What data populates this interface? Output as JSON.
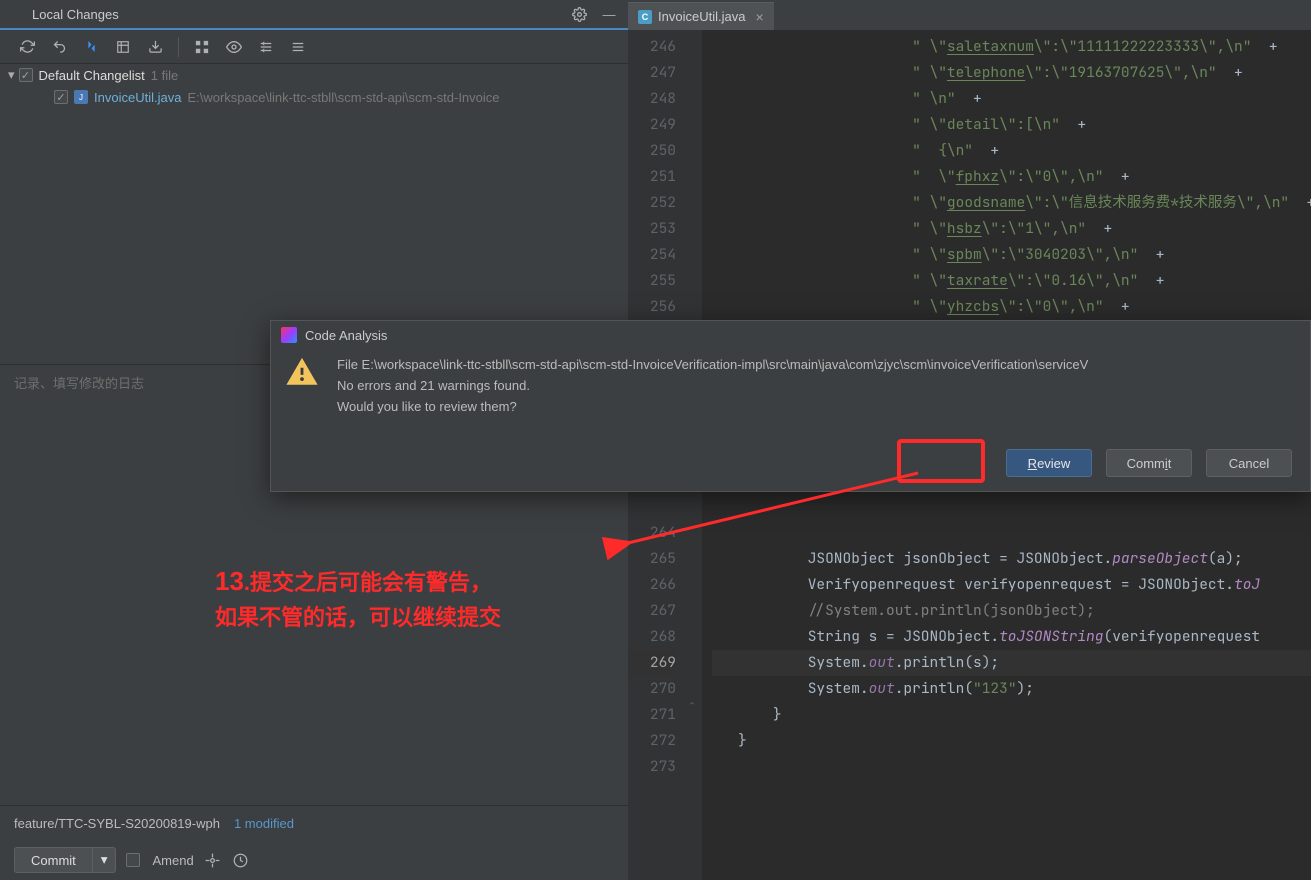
{
  "leftPanel": {
    "title": "Local Changes",
    "changelist": {
      "label": "Default Changelist",
      "count": "1 file"
    },
    "file": {
      "name": "InvoiceUtil.java",
      "path": "E:\\workspace\\link-ttc-stbll\\scm-std-api\\scm-std-Invoice"
    },
    "message_placeholder": "记录、填写修改的日志",
    "branch": "feature/TTC-SYBL-S20200819-wph",
    "modified": "1 modified",
    "commit_label": "Commit",
    "amend_label": "Amend"
  },
  "annotation": {
    "num": "13",
    "line1": "提交之后可能会有警告，",
    "line2": "如果不管的话，可以继续提交"
  },
  "editor": {
    "tab_name": "InvoiceUtil.java",
    "lines": [
      {
        "n": 246,
        "seg": [
          [
            "str",
            "\" \\\""
          ],
          [
            "ul",
            "saletaxnum"
          ],
          [
            "str",
            "\\\":\\\"11111222223333\\\",\\n\""
          ],
          [
            "pun",
            "  +"
          ]
        ]
      },
      {
        "n": 247,
        "seg": [
          [
            "str",
            "\" \\\""
          ],
          [
            "ul",
            "telephone"
          ],
          [
            "str",
            "\\\":\\\"19163707625\\\",\\n\""
          ],
          [
            "pun",
            "  +"
          ]
        ]
      },
      {
        "n": 248,
        "seg": [
          [
            "str",
            "\" \\n\""
          ],
          [
            "pun",
            "  +"
          ]
        ]
      },
      {
        "n": 249,
        "seg": [
          [
            "str",
            "\" \\\"detail\\\":[\\n\""
          ],
          [
            "pun",
            "  +"
          ]
        ]
      },
      {
        "n": 250,
        "seg": [
          [
            "str",
            "\"  {\\n\""
          ],
          [
            "pun",
            "  +"
          ]
        ]
      },
      {
        "n": 251,
        "seg": [
          [
            "str",
            "\"  \\\""
          ],
          [
            "ul",
            "fphxz"
          ],
          [
            "str",
            "\\\":\\\"0\\\",\\n\""
          ],
          [
            "pun",
            "  +"
          ]
        ]
      },
      {
        "n": 252,
        "seg": [
          [
            "str",
            "\" \\\""
          ],
          [
            "ul",
            "goodsname"
          ],
          [
            "str",
            "\\\":\\\"信息技术服务费*技术服务\\\",\\n\""
          ],
          [
            "pun",
            "  +"
          ]
        ]
      },
      {
        "n": 253,
        "seg": [
          [
            "str",
            "\" \\\""
          ],
          [
            "ul",
            "hsbz"
          ],
          [
            "str",
            "\\\":\\\"1\\\",\\n\""
          ],
          [
            "pun",
            "  +"
          ]
        ]
      },
      {
        "n": 254,
        "seg": [
          [
            "str",
            "\" \\\""
          ],
          [
            "ul",
            "spbm"
          ],
          [
            "str",
            "\\\":\\\"3040203\\\",\\n\""
          ],
          [
            "pun",
            "  +"
          ]
        ]
      },
      {
        "n": 255,
        "seg": [
          [
            "str",
            "\" \\\""
          ],
          [
            "ul",
            "taxrate"
          ],
          [
            "str",
            "\\\":\\\"0.16\\\",\\n\""
          ],
          [
            "pun",
            "  +"
          ]
        ]
      },
      {
        "n": 256,
        "seg": [
          [
            "str",
            "\" \\\""
          ],
          [
            "ul",
            "yhzcbs"
          ],
          [
            "str",
            "\\\":\\\"0\\\",\\n\""
          ],
          [
            "pun",
            "  +"
          ]
        ]
      },
      {
        "n": 264,
        "seg": [],
        "obscured": true
      },
      {
        "n": 265,
        "seg": [
          [
            "type",
            "JSONObject jsonObject = JSONObject."
          ],
          [
            "method-i",
            "parseObject"
          ],
          [
            "pun",
            "(a);"
          ]
        ],
        "obs2": true
      },
      {
        "n": 266,
        "seg": [
          [
            "type",
            "Verifyopenrequest verifyopenrequest = JSONObject."
          ],
          [
            "method-i",
            "toJ"
          ]
        ],
        "obs2": true
      },
      {
        "n": 267,
        "seg": [
          [
            "comment",
            "//System.out.println(jsonObject);"
          ]
        ],
        "obs2": true
      },
      {
        "n": 268,
        "seg": [
          [
            "type",
            "String s = JSONObject."
          ],
          [
            "method-i",
            "toJSONString"
          ],
          [
            "pun",
            "(verifyopenrequest"
          ]
        ]
      },
      {
        "n": 269,
        "seg": [
          [
            "type",
            "System."
          ],
          [
            "field",
            "out"
          ],
          [
            "pun",
            ".println(s);"
          ]
        ],
        "hl": true
      },
      {
        "n": 270,
        "seg": [
          [
            "type",
            "System."
          ],
          [
            "field",
            "out"
          ],
          [
            "pun",
            ".println("
          ],
          [
            "str",
            "\"123\""
          ],
          [
            "pun",
            ");"
          ]
        ]
      },
      {
        "n": 271,
        "seg": [
          [
            "pun",
            "}"
          ]
        ],
        "indent": 1
      },
      {
        "n": 272,
        "seg": [
          [
            "pun",
            "}"
          ]
        ],
        "indent": 0
      },
      {
        "n": 273,
        "seg": []
      }
    ]
  },
  "dialog": {
    "title": "Code Analysis",
    "line1": "File E:\\workspace\\link-ttc-stbll\\scm-std-api\\scm-std-InvoiceVerification-impl\\src\\main\\java\\com\\zjyc\\scm\\invoiceVerification\\serviceV",
    "line2": "No errors and 21 warnings found.",
    "line3": "Would you like to review them?",
    "review": "eview",
    "commit": "t",
    "cancel": "Cancel"
  }
}
